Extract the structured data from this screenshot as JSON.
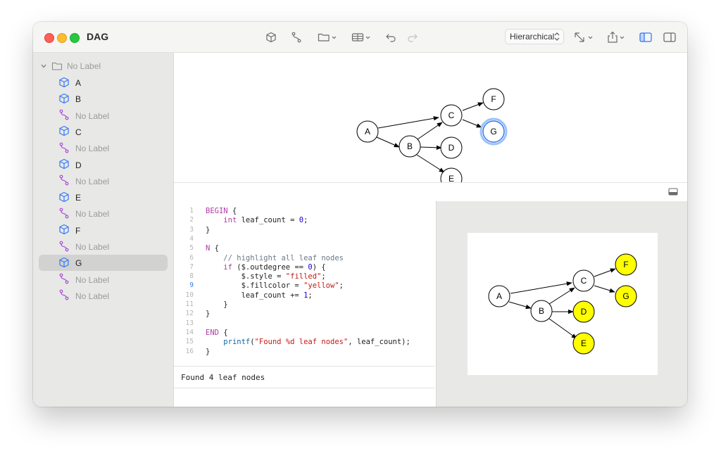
{
  "window": {
    "title": "DAG"
  },
  "toolbar": {
    "layout_value": "Hierarchical",
    "icons": [
      "cube-icon",
      "edge-icon",
      "folder-icon",
      "table-icon",
      "undo-icon",
      "redo-icon",
      "resize-icon",
      "share-icon",
      "left-sidebar-icon",
      "right-sidebar-icon"
    ]
  },
  "sidebar": {
    "root": {
      "label": "No Label"
    },
    "items": [
      {
        "type": "node",
        "label": "A"
      },
      {
        "type": "node",
        "label": "B"
      },
      {
        "type": "edge",
        "label": "No Label"
      },
      {
        "type": "node",
        "label": "C"
      },
      {
        "type": "edge",
        "label": "No Label"
      },
      {
        "type": "node",
        "label": "D"
      },
      {
        "type": "edge",
        "label": "No Label"
      },
      {
        "type": "node",
        "label": "E"
      },
      {
        "type": "edge",
        "label": "No Label"
      },
      {
        "type": "node",
        "label": "F"
      },
      {
        "type": "edge",
        "label": "No Label"
      },
      {
        "type": "node",
        "label": "G",
        "selected": true
      },
      {
        "type": "edge",
        "label": "No Label"
      },
      {
        "type": "edge",
        "label": "No Label"
      }
    ]
  },
  "graph": {
    "nodes": [
      "A",
      "B",
      "C",
      "D",
      "E",
      "F",
      "G"
    ],
    "edges": [
      [
        "A",
        "B"
      ],
      [
        "A",
        "C"
      ],
      [
        "B",
        "C"
      ],
      [
        "B",
        "D"
      ],
      [
        "B",
        "E"
      ],
      [
        "C",
        "F"
      ],
      [
        "C",
        "G"
      ]
    ],
    "selected": "G",
    "selection_color": "#3478f6"
  },
  "editor": {
    "current_line": 9,
    "lines": [
      {
        "n": "1",
        "segs": [
          [
            "kw",
            "BEGIN"
          ],
          [
            "",
            " {"
          ]
        ]
      },
      {
        "n": "2",
        "segs": [
          [
            "",
            "    "
          ],
          [
            "kw",
            "int"
          ],
          [
            "",
            " leaf_count = "
          ],
          [
            "num",
            "0"
          ],
          [
            "",
            ";"
          ]
        ]
      },
      {
        "n": "3",
        "segs": [
          [
            "",
            "}"
          ]
        ]
      },
      {
        "n": "4",
        "segs": []
      },
      {
        "n": "5",
        "segs": [
          [
            "kw",
            "N"
          ],
          [
            "",
            " {"
          ]
        ]
      },
      {
        "n": "6",
        "segs": [
          [
            "cmt",
            "    // highlight all leaf nodes"
          ]
        ]
      },
      {
        "n": "7",
        "segs": [
          [
            "",
            "    "
          ],
          [
            "kw",
            "if"
          ],
          [
            "",
            " ($.outdegree == "
          ],
          [
            "num",
            "0"
          ],
          [
            "",
            ") {"
          ]
        ]
      },
      {
        "n": "8",
        "segs": [
          [
            "",
            "        $.style = "
          ],
          [
            "str",
            "\"filled\""
          ],
          [
            "",
            ";"
          ]
        ]
      },
      {
        "n": "9",
        "segs": [
          [
            "",
            "        $.fillcolor = "
          ],
          [
            "str",
            "\"yellow\""
          ],
          [
            "",
            ";"
          ]
        ]
      },
      {
        "n": "10",
        "segs": [
          [
            "",
            "        leaf_count += "
          ],
          [
            "num",
            "1"
          ],
          [
            "",
            ";"
          ]
        ]
      },
      {
        "n": "11",
        "segs": [
          [
            "",
            "    }"
          ]
        ]
      },
      {
        "n": "12",
        "segs": [
          [
            "",
            "}"
          ]
        ]
      },
      {
        "n": "13",
        "segs": []
      },
      {
        "n": "14",
        "segs": [
          [
            "kw",
            "END"
          ],
          [
            "",
            " {"
          ]
        ]
      },
      {
        "n": "15",
        "segs": [
          [
            "",
            "    "
          ],
          [
            "fn",
            "printf"
          ],
          [
            "",
            "("
          ],
          [
            "str",
            "\"Found %d leaf nodes\""
          ],
          [
            "",
            ", leaf_count);"
          ]
        ]
      },
      {
        "n": "16",
        "segs": [
          [
            "",
            "}"
          ]
        ]
      }
    ]
  },
  "output": {
    "text": "Found 4 leaf nodes"
  },
  "preview": {
    "leaf_nodes": [
      "D",
      "E",
      "F",
      "G"
    ],
    "fill_color": "#ffff00"
  },
  "colors": {
    "node_icon": "#3478f6",
    "edge_icon": "#a64bd8"
  }
}
